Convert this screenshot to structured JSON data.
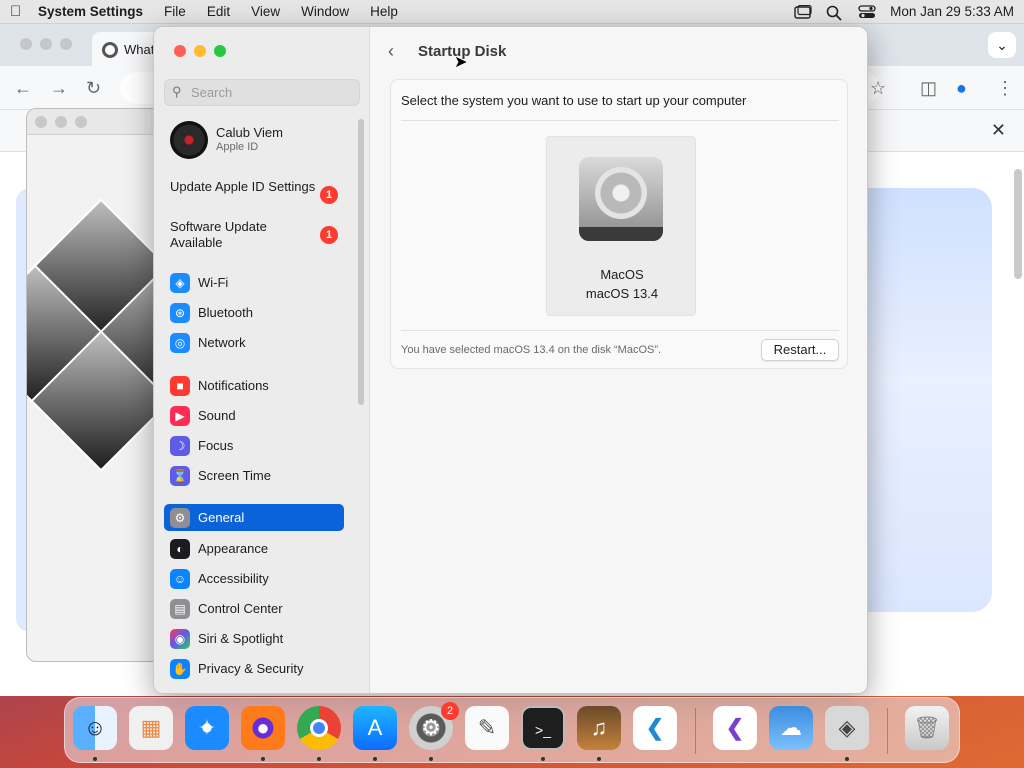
{
  "menubar": {
    "app_name": "System Settings",
    "menus": [
      "File",
      "Edit",
      "View",
      "Window",
      "Help"
    ],
    "datetime": "Mon Jan 29  5:33 AM"
  },
  "browser": {
    "tab_title": "What"
  },
  "sidebar": {
    "search_placeholder": "Search",
    "account": {
      "name": "Calub Viem",
      "subtitle": "Apple ID"
    },
    "notices": [
      {
        "label": "Update Apple ID Settings",
        "badge": "1"
      },
      {
        "label": "Software Update Available",
        "badge": "1"
      }
    ],
    "items": [
      {
        "label": "Wi-Fi",
        "icon": "wifi-icon",
        "color": "#1a8cff"
      },
      {
        "label": "Bluetooth",
        "icon": "bluetooth-icon",
        "color": "#1a8cff"
      },
      {
        "label": "Network",
        "icon": "globe-icon",
        "color": "#1a8cff"
      },
      {
        "label": "Notifications",
        "icon": "bell-icon",
        "color": "#ff3b30"
      },
      {
        "label": "Sound",
        "icon": "speaker-icon",
        "color": "#ff2d55"
      },
      {
        "label": "Focus",
        "icon": "moon-icon",
        "color": "#5e5ce6"
      },
      {
        "label": "Screen Time",
        "icon": "hourglass-icon",
        "color": "#5e5ce6"
      },
      {
        "label": "General",
        "icon": "gear-icon",
        "color": "#8e8e93"
      },
      {
        "label": "Appearance",
        "icon": "appearance-icon",
        "color": "#1c1c1e"
      },
      {
        "label": "Accessibility",
        "icon": "accessibility-icon",
        "color": "#0a84ff"
      },
      {
        "label": "Control Center",
        "icon": "control-center-icon",
        "color": "#8e8e93"
      },
      {
        "label": "Siri & Spotlight",
        "icon": "siri-icon",
        "color": "#bf5af2"
      },
      {
        "label": "Privacy & Security",
        "icon": "hand-icon",
        "color": "#0a84ff"
      }
    ],
    "selected": "General"
  },
  "main": {
    "title": "Startup Disk",
    "instruction": "Select the system you want to use to start up your computer",
    "disk": {
      "name": "MacOS",
      "version": "macOS 13.4"
    },
    "selection_text": "You have selected macOS 13.4 on the disk “MacOS”.",
    "restart_label": "Restart..."
  },
  "dock": {
    "apps": [
      "Finder",
      "Launchpad",
      "Safari",
      "Firefox",
      "Chrome",
      "App Store",
      "System Settings",
      "TextEdit",
      "Terminal",
      "GarageBand",
      "Visual Studio Code",
      "Visual Studio",
      "Weather",
      "Boot Camp Assistant",
      "Trash"
    ],
    "settings_badge": "2"
  }
}
